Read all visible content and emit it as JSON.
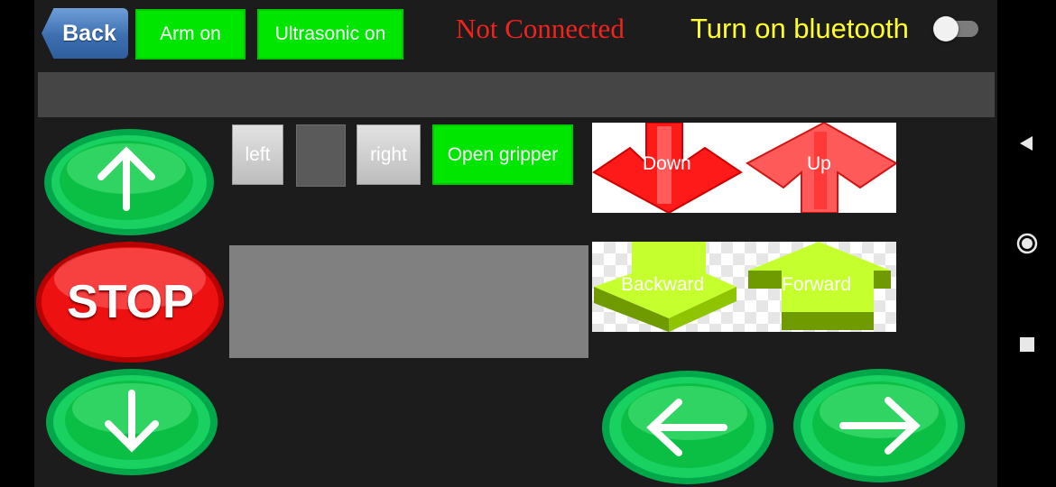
{
  "header": {
    "back_label": "Back",
    "arm_label": "Arm on",
    "ultrasonic_label": "Ultrasonic on",
    "status": "Not Connected",
    "bluetooth_label": "Turn on bluetooth",
    "bluetooth_toggle": "off"
  },
  "controls": {
    "left_label": "left",
    "right_label": "right",
    "gripper_label": "Open gripper"
  },
  "images": {
    "down_label": "Down",
    "up_label": "Up",
    "backward_label": "Backward",
    "forward_label": "Forward"
  },
  "drive": {
    "stop_label": "STOP",
    "up_icon": "arrow-up-icon",
    "down_icon": "arrow-down-icon",
    "left_icon": "arrow-left-icon",
    "right_icon": "arrow-right-icon"
  },
  "colors": {
    "status": "#f0241d",
    "bluetooth_label": "#ffff2e",
    "green_button": "#00e600",
    "background": "#1c1c1c"
  },
  "system_nav": {
    "back_icon": "triangle-back-icon",
    "home_icon": "circle-home-icon",
    "recents_icon": "square-recents-icon"
  }
}
